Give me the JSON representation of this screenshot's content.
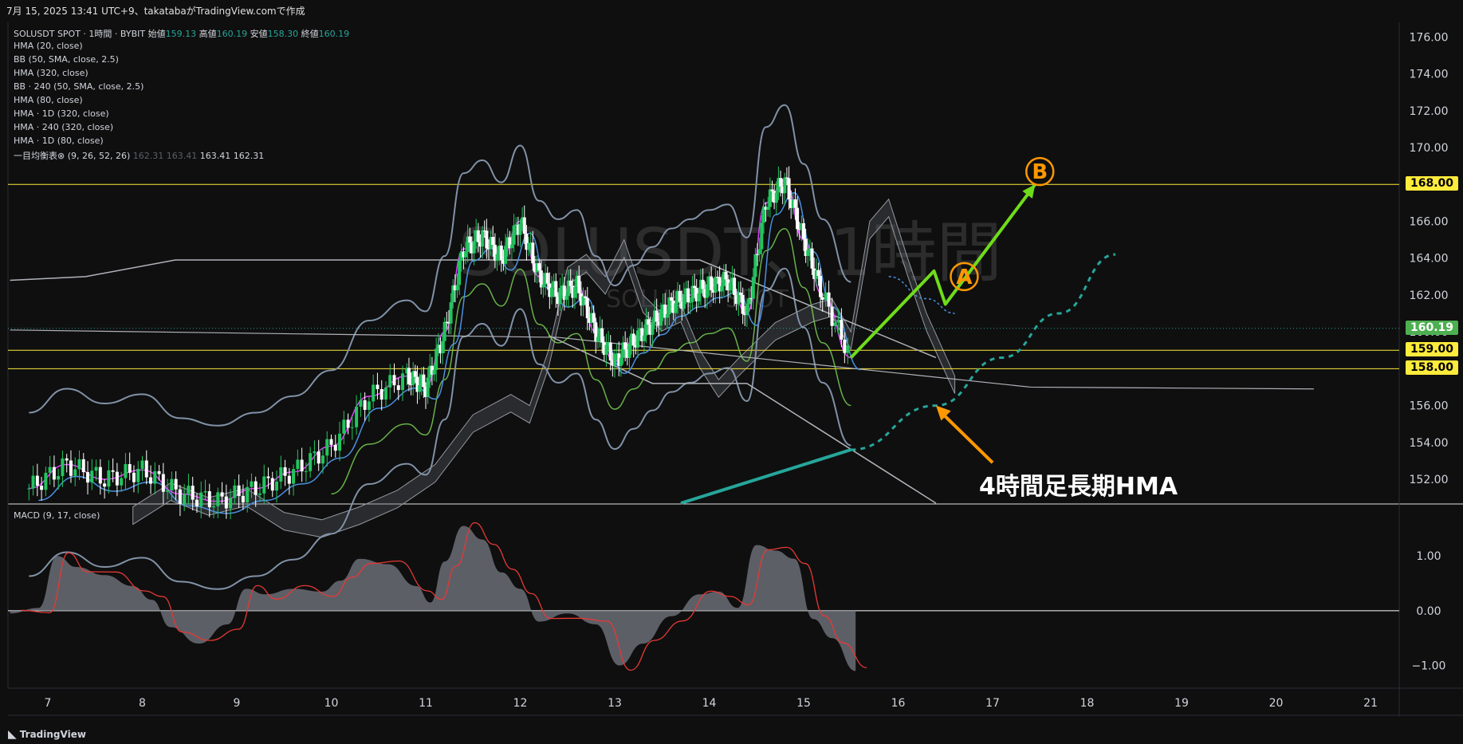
{
  "header": {
    "title": "7月 15, 2025 13:41 UTC+9、takatabaがTradingView.comで作成"
  },
  "legend": {
    "symbol": "SOLUSDT SPOT · 1時間 · BYBIT",
    "ohlc": [
      {
        "label": "始値",
        "value": "159.13"
      },
      {
        "label": "高値",
        "value": "160.19"
      },
      {
        "label": "安値",
        "value": "158.30"
      },
      {
        "label": "終値",
        "value": "160.19"
      }
    ],
    "indicators": [
      "HMA (20, close)",
      "BB (50, SMA, close, 2.5)",
      "HMA (320, close)",
      "BB · 240 (50, SMA, close, 2.5)",
      "HMA (80, close)",
      "HMA · 1D (320, close)",
      "HMA · 240 (320, close)",
      "HMA · 1D (80, close)"
    ],
    "ichimoku": {
      "name": "一目均衡表⊗ (9, 26, 52, 26)",
      "values": [
        "162.31",
        "163.41",
        "163.41",
        "162.31"
      ]
    }
  },
  "watermark": {
    "symbol": "SOLUSDT、1時間",
    "sub": "SOLUSDT SPOT"
  },
  "annotations": {
    "label_a": "A",
    "label_b": "B",
    "hma_note": "4時間足長期HMA"
  },
  "macd": {
    "label": "MACD (9, 17, close)"
  },
  "footer": {
    "brand": "TradingView"
  },
  "colors": {
    "up": "#22c55e",
    "down": "#ffffff",
    "accent_green": "#6fdc1a",
    "orange": "#ff9800",
    "teal": "#26a69a",
    "level": "#ffeb3b"
  },
  "chart_data": {
    "type": "line",
    "x_ticks": [
      "7",
      "8",
      "9",
      "10",
      "11",
      "12",
      "13",
      "14",
      "15",
      "16",
      "17",
      "18",
      "19",
      "20",
      "21"
    ],
    "price_axis": {
      "ylim": [
        150.7,
        176.8
      ],
      "ticks": [
        152,
        154,
        156,
        158,
        160,
        162,
        164,
        166,
        168,
        170,
        172,
        174,
        176
      ]
    },
    "price_labels": [
      {
        "value": 168.0,
        "text": "168.00",
        "style": "level"
      },
      {
        "value": 160.19,
        "text": "160.19",
        "style": "last"
      },
      {
        "value": 159.0,
        "text": "159.00",
        "style": "level"
      },
      {
        "value": 158.0,
        "text": "158.00",
        "style": "level"
      }
    ],
    "horizontal_levels": [
      168,
      159,
      158
    ],
    "last_price": 160.19,
    "close_series": {
      "name": "SOLUSDT",
      "x": [
        6.8,
        7.2,
        7.6,
        8.0,
        8.4,
        8.8,
        9.2,
        9.6,
        10.0,
        10.4,
        10.8,
        11.0,
        11.2,
        11.4,
        11.6,
        11.8,
        12.0,
        12.2,
        12.4,
        12.6,
        12.8,
        13.0,
        13.2,
        13.4,
        13.6,
        13.8,
        14.0,
        14.2,
        14.4,
        14.6,
        14.8,
        15.0,
        15.2,
        15.5
      ],
      "y": [
        151.5,
        152.8,
        152.0,
        152.5,
        151.2,
        150.8,
        151.5,
        152.4,
        153.8,
        156.5,
        157.6,
        157.0,
        160.0,
        164.5,
        165.2,
        164.0,
        166.0,
        163.0,
        162.0,
        162.5,
        160.0,
        158.4,
        159.5,
        160.5,
        161.5,
        162.0,
        162.5,
        162.8,
        161.0,
        167.0,
        168.2,
        165.0,
        162.0,
        158.6
      ]
    },
    "projection": {
      "x": [
        15.5,
        16.38,
        16.5,
        17.45
      ],
      "y": [
        158.6,
        163.3,
        161.5,
        168.0
      ]
    },
    "macd_axis": {
      "ylim": [
        -1.4,
        1.95
      ],
      "ticks": [
        1.0,
        0.0,
        -1.0
      ]
    },
    "macd_series": {
      "x": [
        6.6,
        6.9,
        7.1,
        7.3,
        7.6,
        7.9,
        8.1,
        8.3,
        8.6,
        8.9,
        9.1,
        9.3,
        9.6,
        9.9,
        10.1,
        10.3,
        10.6,
        10.9,
        11.05,
        11.2,
        11.4,
        11.6,
        11.8,
        12.0,
        12.2,
        12.5,
        12.8,
        13.05,
        13.3,
        13.6,
        13.9,
        14.1,
        14.3,
        14.5,
        14.7,
        14.9,
        15.1,
        15.3,
        15.55
      ],
      "y": [
        -0.05,
        0.05,
        1.0,
        0.8,
        0.65,
        0.45,
        0.2,
        -0.3,
        -0.6,
        -0.25,
        0.4,
        0.3,
        0.4,
        0.35,
        0.55,
        0.95,
        0.85,
        0.45,
        0.15,
        0.9,
        1.55,
        1.3,
        0.7,
        0.4,
        -0.2,
        -0.05,
        -0.25,
        -1.0,
        -0.6,
        -0.1,
        0.3,
        0.35,
        0.05,
        1.2,
        1.1,
        0.95,
        -0.15,
        -0.5,
        -1.1
      ]
    }
  }
}
